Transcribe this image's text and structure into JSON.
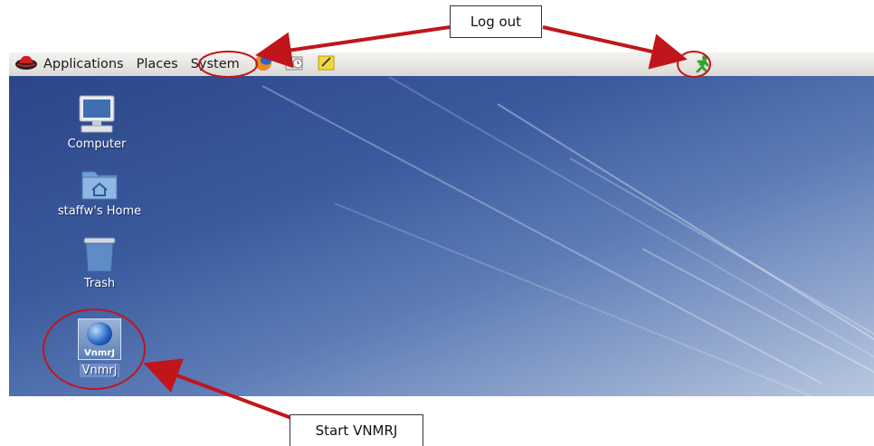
{
  "panel": {
    "menus": [
      "Applications",
      "Places",
      "System"
    ]
  },
  "desktop": {
    "icons": [
      {
        "label": "Computer"
      },
      {
        "label": "staffw's Home"
      },
      {
        "label": "Trash"
      },
      {
        "label": "Vnmrj",
        "badge": "VnmrJ"
      }
    ]
  },
  "annotations": {
    "logout_label": "Log out",
    "vnmrj_label": "Start VNMRJ"
  },
  "colors": {
    "annotation": "#c0161b",
    "desktop": "#3a5a9e",
    "panel": "#e8e6e2"
  },
  "icons": [
    "redhat-icon",
    "firefox-icon",
    "clock-icon",
    "notes-icon",
    "logout-runner-icon"
  ]
}
